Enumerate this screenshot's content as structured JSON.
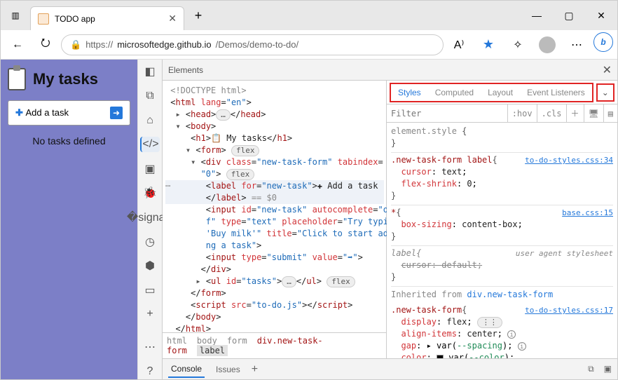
{
  "browser": {
    "tab_title": "TODO app",
    "url_prefix": "https://",
    "url_domain": "microsoftedge.github.io",
    "url_path": "/Demos/demo-to-do/"
  },
  "page": {
    "heading": "My tasks",
    "add_label": "Add a task",
    "empty": "No tasks defined"
  },
  "devtools": {
    "panel": "Elements",
    "tabs": {
      "styles": "Styles",
      "computed": "Computed",
      "layout": "Layout",
      "eventListeners": "Event Listeners"
    },
    "filter_placeholder": "Filter",
    "hov": ":hov",
    "cls": ".cls",
    "crumbs": {
      "html": "html",
      "body": "body",
      "form": "form",
      "div": "div.new-task-form",
      "label": "label"
    },
    "dom": {
      "doctype": "<!DOCTYPE html>",
      "html_open": "html",
      "lang_attr": "lang",
      "lang_val": "\"en\"",
      "head": "head",
      "ellipsis": "…",
      "body": "body",
      "h1": "h1",
      "h1_text": " My tasks",
      "form": "form",
      "flex_pill": "flex",
      "div": "div",
      "class_attr": "class",
      "class_val": "\"new-task-form\"",
      "tabindex_attr": "tabindex",
      "tabindex_val": "\"0\"",
      "label": "label",
      "for_attr": "for",
      "for_val": "\"new-task\"",
      "label_text": " Add a task",
      "eq_sel": " == $0",
      "input": "input",
      "id_attr": "id",
      "id_val": "\"new-task\"",
      "autocomplete_attr": "autocomplete",
      "autocomplete_val": "\"off\"",
      "type_attr": "type",
      "type_text_val": "\"text\"",
      "placeholder_attr": "placeholder",
      "placeholder_val": "\"Try typing 'Buy milk'\"",
      "title_attr": "title",
      "title_val": "\"Click to start adding a task\"",
      "type_submit_val": "\"submit\"",
      "value_attr": "value",
      "value_val": "\"➡\"",
      "ul": "ul",
      "ul_id_val": "\"tasks\"",
      "script": "script",
      "src_attr": "src",
      "src_val": "\"to-do.js\""
    },
    "styles_pane": {
      "element_style": "element.style",
      "rule1_sel": ".new-task-form label",
      "rule1_src": "to-do-styles.css:34",
      "rule1_p1": "cursor",
      "rule1_v1": "text",
      "rule1_p2": "flex-shrink",
      "rule1_v2": "0",
      "rule2_sel": "*",
      "rule2_src": "base.css:15",
      "rule2_p1": "box-sizing",
      "rule2_v1": "content-box",
      "rule3_sel": "label",
      "rule3_src": "user agent stylesheet",
      "rule3_p1": "cursor",
      "rule3_v1": "default",
      "inherit": "Inherited from ",
      "inherit_link": "div.new-task-form",
      "rule4_sel": ".new-task-form",
      "rule4_src": "to-do-styles.css:17",
      "rule4_p1": "display",
      "rule4_v1": "flex",
      "rule4_p2": "align-items",
      "rule4_v2": "center",
      "rule4_p3": "gap",
      "rule4_v3a": "var(",
      "rule4_v3b": "--spacing",
      "rule4_v3c": ")",
      "rule4_p4": "color",
      "rule4_v4a": "var(",
      "rule4_v4b": "--color",
      "rule4_v4c": ")"
    },
    "drawer": {
      "console": "Console",
      "issues": "Issues"
    }
  }
}
